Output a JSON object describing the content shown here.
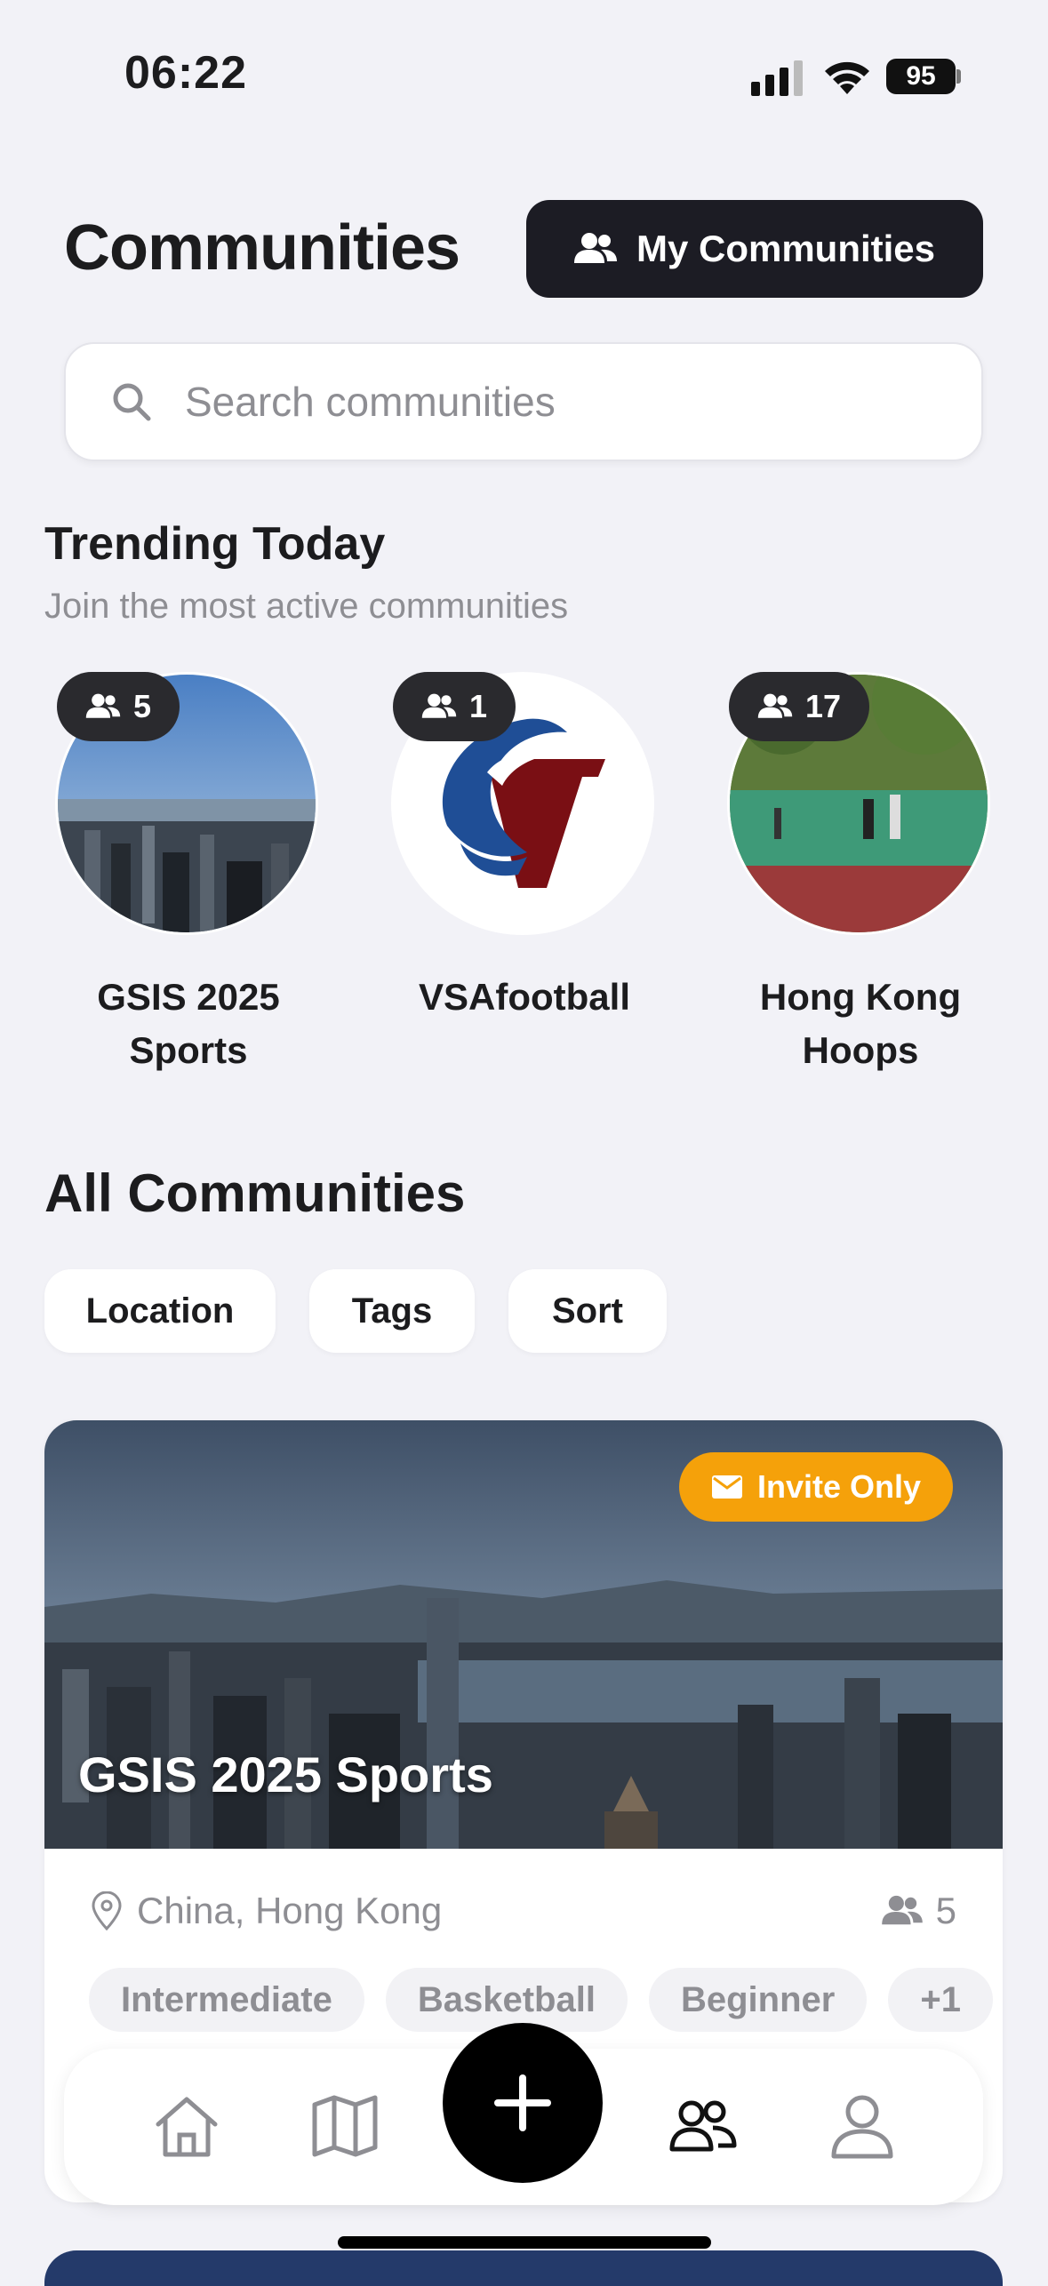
{
  "status_bar": {
    "time": "06:22",
    "battery": "95"
  },
  "header": {
    "title": "Communities",
    "my_communities_label": "My Communities"
  },
  "search": {
    "placeholder": "Search communities"
  },
  "trending": {
    "title": "Trending Today",
    "subtitle": "Join the most active communities",
    "items": [
      {
        "name": "GSIS 2025 Sports",
        "members": "5"
      },
      {
        "name": "VSAfootball",
        "members": "1"
      },
      {
        "name": "Hong Kong Hoops",
        "members": "17"
      }
    ]
  },
  "all": {
    "title": "All Communities",
    "filters": [
      "Location",
      "Tags",
      "Sort"
    ]
  },
  "card": {
    "title": "GSIS 2025 Sports",
    "badge": "Invite Only",
    "location": "China, Hong Kong",
    "members": "5",
    "tags": [
      "Intermediate",
      "Basketball",
      "Beginner",
      "+1"
    ]
  },
  "nav": {
    "items": [
      "home-icon",
      "map-icon",
      "add-icon",
      "communities-icon",
      "profile-icon"
    ]
  },
  "colors": {
    "accent": "#f5a10a",
    "dark_button": "#1c1c24",
    "background": "#f2f2f7"
  }
}
